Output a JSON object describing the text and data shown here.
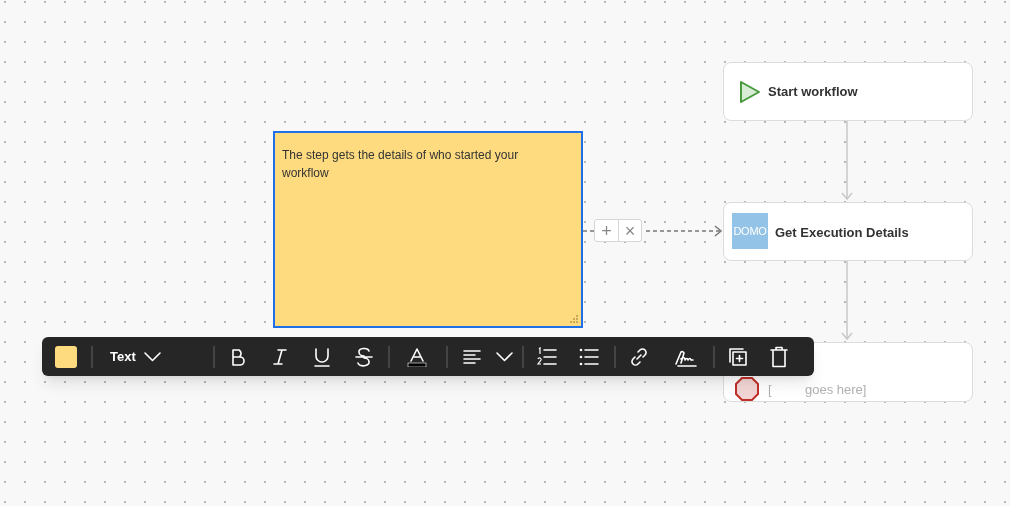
{
  "note": {
    "text": "The step gets the details of who started your workflow",
    "color": "#ffdb80",
    "selected": true
  },
  "connector_controls": [
    "+",
    "×"
  ],
  "nodes": [
    {
      "kind": "start",
      "label": "Start workflow"
    },
    {
      "kind": "logo",
      "label": "Get Execution Details",
      "logo_text": "DOMO"
    },
    {
      "kind": "stop",
      "bracket": "[",
      "label": "goes here]"
    }
  ],
  "toolbar": {
    "style_dropdown": "Text"
  }
}
